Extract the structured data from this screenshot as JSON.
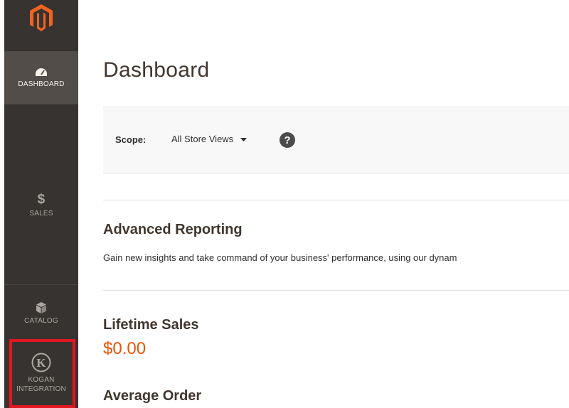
{
  "sidebar": {
    "items": [
      {
        "label": "DASHBOARD",
        "icon": "speedometer-icon",
        "active": true
      },
      {
        "label": "SALES",
        "icon": "dollar-icon",
        "glyph": "$"
      },
      {
        "label": "CATALOG",
        "icon": "box-icon"
      },
      {
        "label_line1": "KOGAN",
        "label_line2": "INTEGRATION",
        "icon": "kogan-logo-icon",
        "glyph": "K",
        "highlighted": true
      }
    ],
    "logo": "magento-logo"
  },
  "page": {
    "title": "Dashboard"
  },
  "scope": {
    "label": "Scope:",
    "value": "All Store Views",
    "help": "?"
  },
  "advanced_reporting": {
    "heading": "Advanced Reporting",
    "text": "Gain new insights and take command of your business' performance, using our dynam"
  },
  "lifetime_sales": {
    "heading": "Lifetime Sales",
    "value": "$0.00"
  },
  "average_order": {
    "heading": "Average Order"
  },
  "colors": {
    "sidebar_bg": "#373330",
    "sidebar_active": "#524d49",
    "accent_orange": "#eb5202",
    "highlight_red": "#e0171f"
  }
}
